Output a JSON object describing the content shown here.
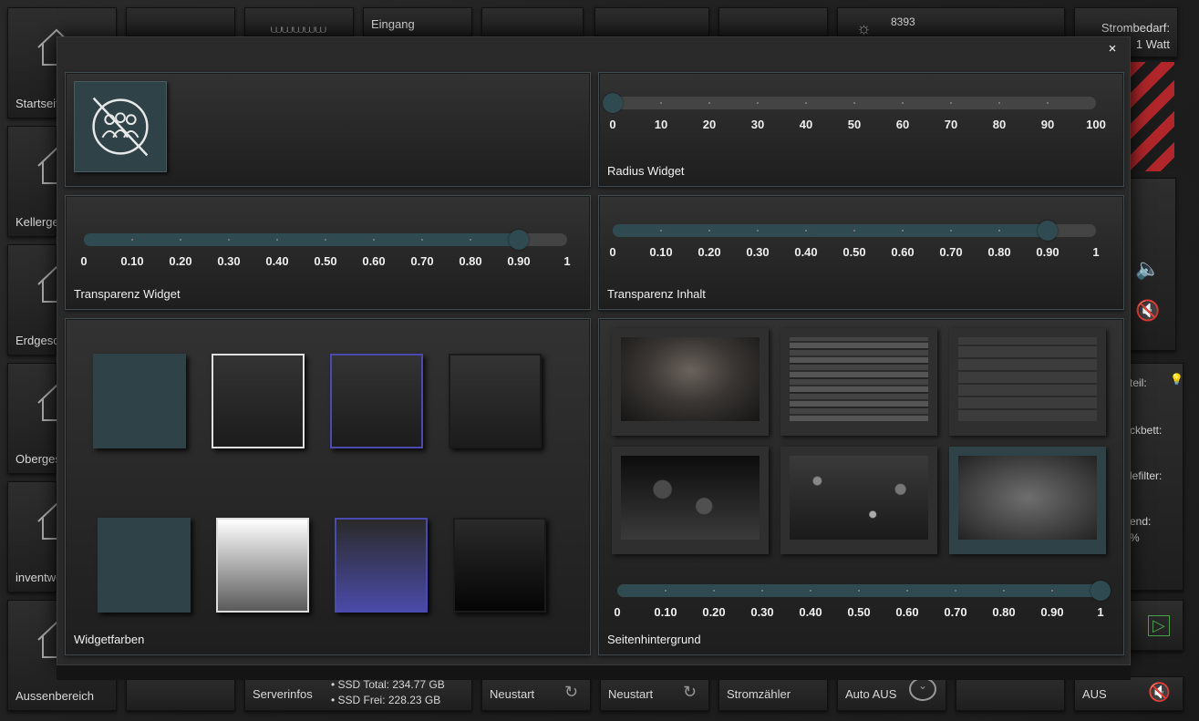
{
  "background": {
    "tiles": [
      "Startseite",
      "Kellergeschoss",
      "Erdgeschoss",
      "Obergeschoss",
      "inventwo",
      "Aussenbereich"
    ],
    "eingang": "Eingang",
    "weather_value": "8393",
    "strom_label": "Strombedarf:",
    "strom_value": "1 Watt",
    "bottom": {
      "serverinfos": "Serverinfos",
      "ssd_total": "• SSD Total: 234.77 GB",
      "ssd_frei": "• SSD Frei: 228.23 GB",
      "neustart1": "Neustart",
      "neustart2": "Neustart",
      "stromzaehler": "Stromzähler",
      "auto_aus": "Auto AUS",
      "aus": "AUS"
    },
    "right_partial": {
      "teil": "teil:",
      "ckbett": "ckbett:",
      "lefilter": "lefilter:",
      "end": "end:",
      "pct": "%"
    }
  },
  "modal": {
    "close_label": "×",
    "radius": {
      "title": "Radius Widget",
      "min": 0,
      "max": 100,
      "value": 0,
      "labels": [
        "0",
        "10",
        "20",
        "30",
        "40",
        "50",
        "60",
        "70",
        "80",
        "90",
        "100"
      ]
    },
    "transparenz_widget": {
      "title": "Transparenz Widget",
      "min": 0,
      "max": 1,
      "value": 0.9,
      "labels": [
        "0",
        "0.10",
        "0.20",
        "0.30",
        "0.40",
        "0.50",
        "0.60",
        "0.70",
        "0.80",
        "0.90",
        "1"
      ]
    },
    "transparenz_inhalt": {
      "title": "Transparenz Inhalt",
      "min": 0,
      "max": 1,
      "value": 0.9,
      "labels": [
        "0",
        "0.10",
        "0.20",
        "0.30",
        "0.40",
        "0.50",
        "0.60",
        "0.70",
        "0.80",
        "0.90",
        "1"
      ]
    },
    "widgetfarben": {
      "title": "Widgetfarben",
      "row1": [
        {
          "fill": "#2f4247",
          "border": "#2f4247"
        },
        {
          "fill": "#262626",
          "border": "#e0e0e0"
        },
        {
          "fill": "#262626",
          "border": "#4a4ab0"
        },
        {
          "fill": "#222222",
          "border": "#1a1a1a"
        }
      ],
      "row2": [
        {
          "fill": "#2f4247",
          "border": "#2f4247"
        },
        {
          "fill": "gradient-white",
          "border": "#dddddd"
        },
        {
          "fill": "gradient-blue",
          "border": "#4a4ab0"
        },
        {
          "fill": "gradient-black",
          "border": "#1a1a1a"
        }
      ]
    },
    "seitenhintergrund": {
      "title": "Seitenhintergrund",
      "min": 0,
      "max": 1,
      "value": 1,
      "labels": [
        "0",
        "0.10",
        "0.20",
        "0.30",
        "0.40",
        "0.50",
        "0.60",
        "0.70",
        "0.80",
        "0.90",
        "1"
      ],
      "selected_index": 5,
      "images": [
        "dark-wood-boards",
        "stone-tile-planks",
        "grey-horizontal-planks",
        "hexagon-tiles",
        "gravel-stones",
        "concrete-wall"
      ]
    }
  }
}
